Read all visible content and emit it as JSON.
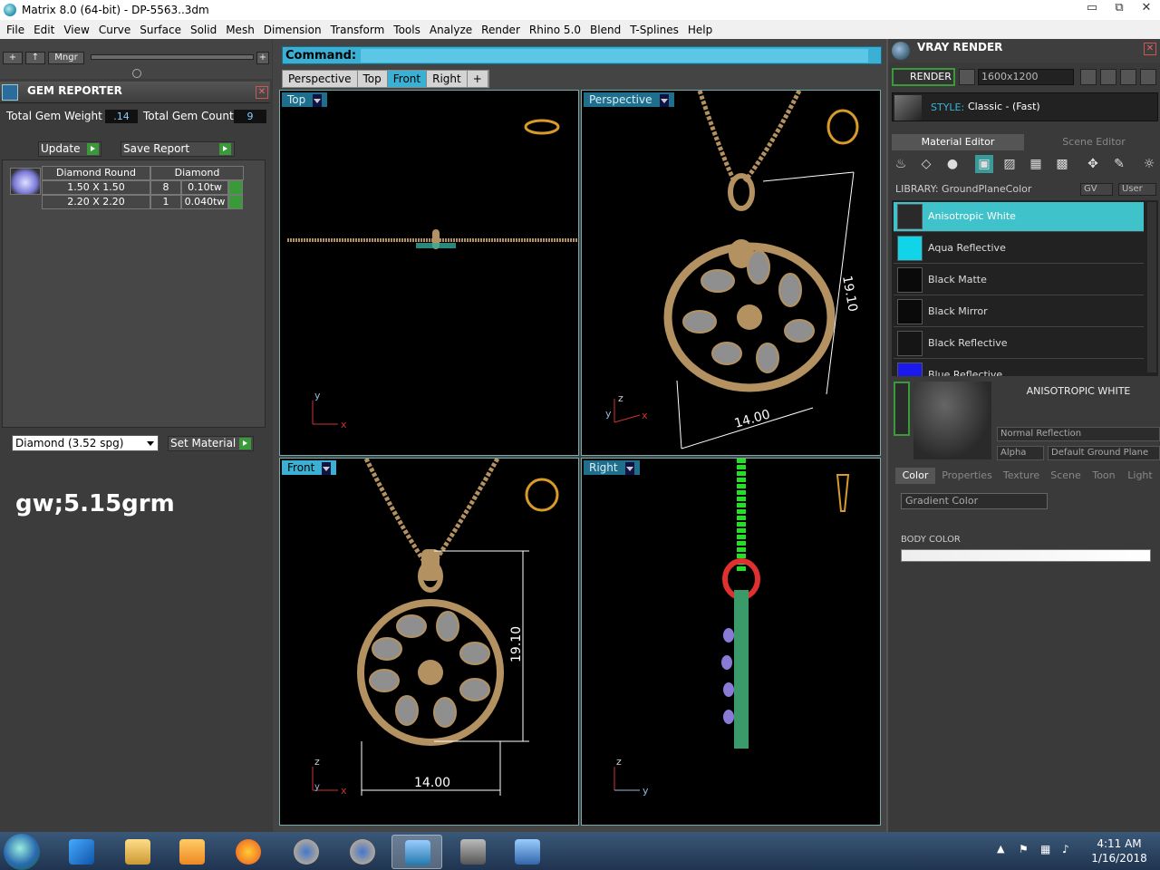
{
  "window": {
    "title": "Matrix 8.0 (64-bit) - DP-5563..3dm",
    "minimize": "▭",
    "restore": "⧉",
    "close": "✕"
  },
  "menu": [
    "File",
    "Edit",
    "View",
    "Curve",
    "Surface",
    "Solid",
    "Mesh",
    "Dimension",
    "Transform",
    "Tools",
    "Analyze",
    "Render",
    "Rhino 5.0",
    "Blend",
    "T-Splines",
    "Help"
  ],
  "left_toolbar": {
    "add": "+",
    "up": "↑",
    "mngr": "Mngr",
    "plus": "+"
  },
  "gem_reporter": {
    "title": "GEM REPORTER",
    "close": "✕",
    "total_weight_label": "Total Gem Weight",
    "total_weight_value": ".14",
    "total_count_label": "Total Gem Count",
    "total_count_value": "9",
    "update_label": "Update",
    "save_report_label": "Save Report",
    "table_headers": [
      "Diamond Round",
      "Diamond"
    ],
    "rows": [
      {
        "size": "1.50 X 1.50",
        "count": "8",
        "weight": "0.10tw"
      },
      {
        "size": "2.20 X 2.20",
        "count": "1",
        "weight": "0.040tw"
      }
    ],
    "material_select": "Diamond    (3.52 spg)",
    "set_material_label": "Set Material"
  },
  "note": "gw;5.15grm",
  "command": {
    "label": "Command:"
  },
  "view_tabs": [
    "Perspective",
    "Top",
    "Front",
    "Right",
    "+"
  ],
  "active_view_tab": "Front",
  "viewports": {
    "top": {
      "label": "Top"
    },
    "perspective": {
      "label": "Perspective",
      "dim_height": "19.10",
      "dim_width": "14.00"
    },
    "front": {
      "label": "Front",
      "dim_height": "19.10",
      "dim_width": "14.00"
    },
    "right": {
      "label": "Right"
    }
  },
  "axes": {
    "x": "x",
    "y": "y",
    "z": "z"
  },
  "vray": {
    "title": "VRAY RENDER",
    "close": "✕",
    "render_label": "RENDER",
    "resolution": "1600x1200",
    "style_label": "STYLE:",
    "style_value": "Classic - (Fast)",
    "tabs": [
      "Material Editor",
      "Scene Editor"
    ],
    "library_label": "LIBRARY: GroundPlaneColor",
    "gv_label": "GV",
    "user_label": "User",
    "materials": [
      {
        "name": "Anisotropic White",
        "color": "#2a2a2a",
        "selected": true
      },
      {
        "name": "Aqua Reflective",
        "color": "#11d4e8",
        "selected": false
      },
      {
        "name": "Black Matte",
        "color": "#0a0a0a",
        "selected": false
      },
      {
        "name": "Black Mirror",
        "color": "#0a0a0a",
        "selected": false
      },
      {
        "name": "Black Reflective",
        "color": "#151515",
        "selected": false
      },
      {
        "name": "Blue Reflective",
        "color": "#1a1aee",
        "selected": false
      }
    ],
    "preview_title": "ANISOTROPIC WHITE",
    "reflection_select": "Normal Reflection",
    "alpha_label": "Alpha",
    "ground_plane_label": "Default Ground Plane",
    "prop_tabs": [
      "Color",
      "Properties",
      "Texture",
      "Scene",
      "Toon",
      "Light"
    ],
    "active_prop_tab": "Color",
    "gradient_select": "Gradient Color",
    "body_color_label": "BODY COLOR"
  },
  "taskbar": {
    "time": "4:11 AM",
    "date": "1/16/2018",
    "apps": [
      "internet-explorer",
      "file-explorer",
      "media-player",
      "firefox",
      "matrix-ring",
      "matrix-ring-2",
      "matrix-v8",
      "remote-desktop",
      "photo-viewer"
    ]
  },
  "colors": {
    "accent": "#3ab0d4",
    "gold": "#b39160",
    "gem": "#8a7ad8",
    "green": "#3a9a3a"
  }
}
